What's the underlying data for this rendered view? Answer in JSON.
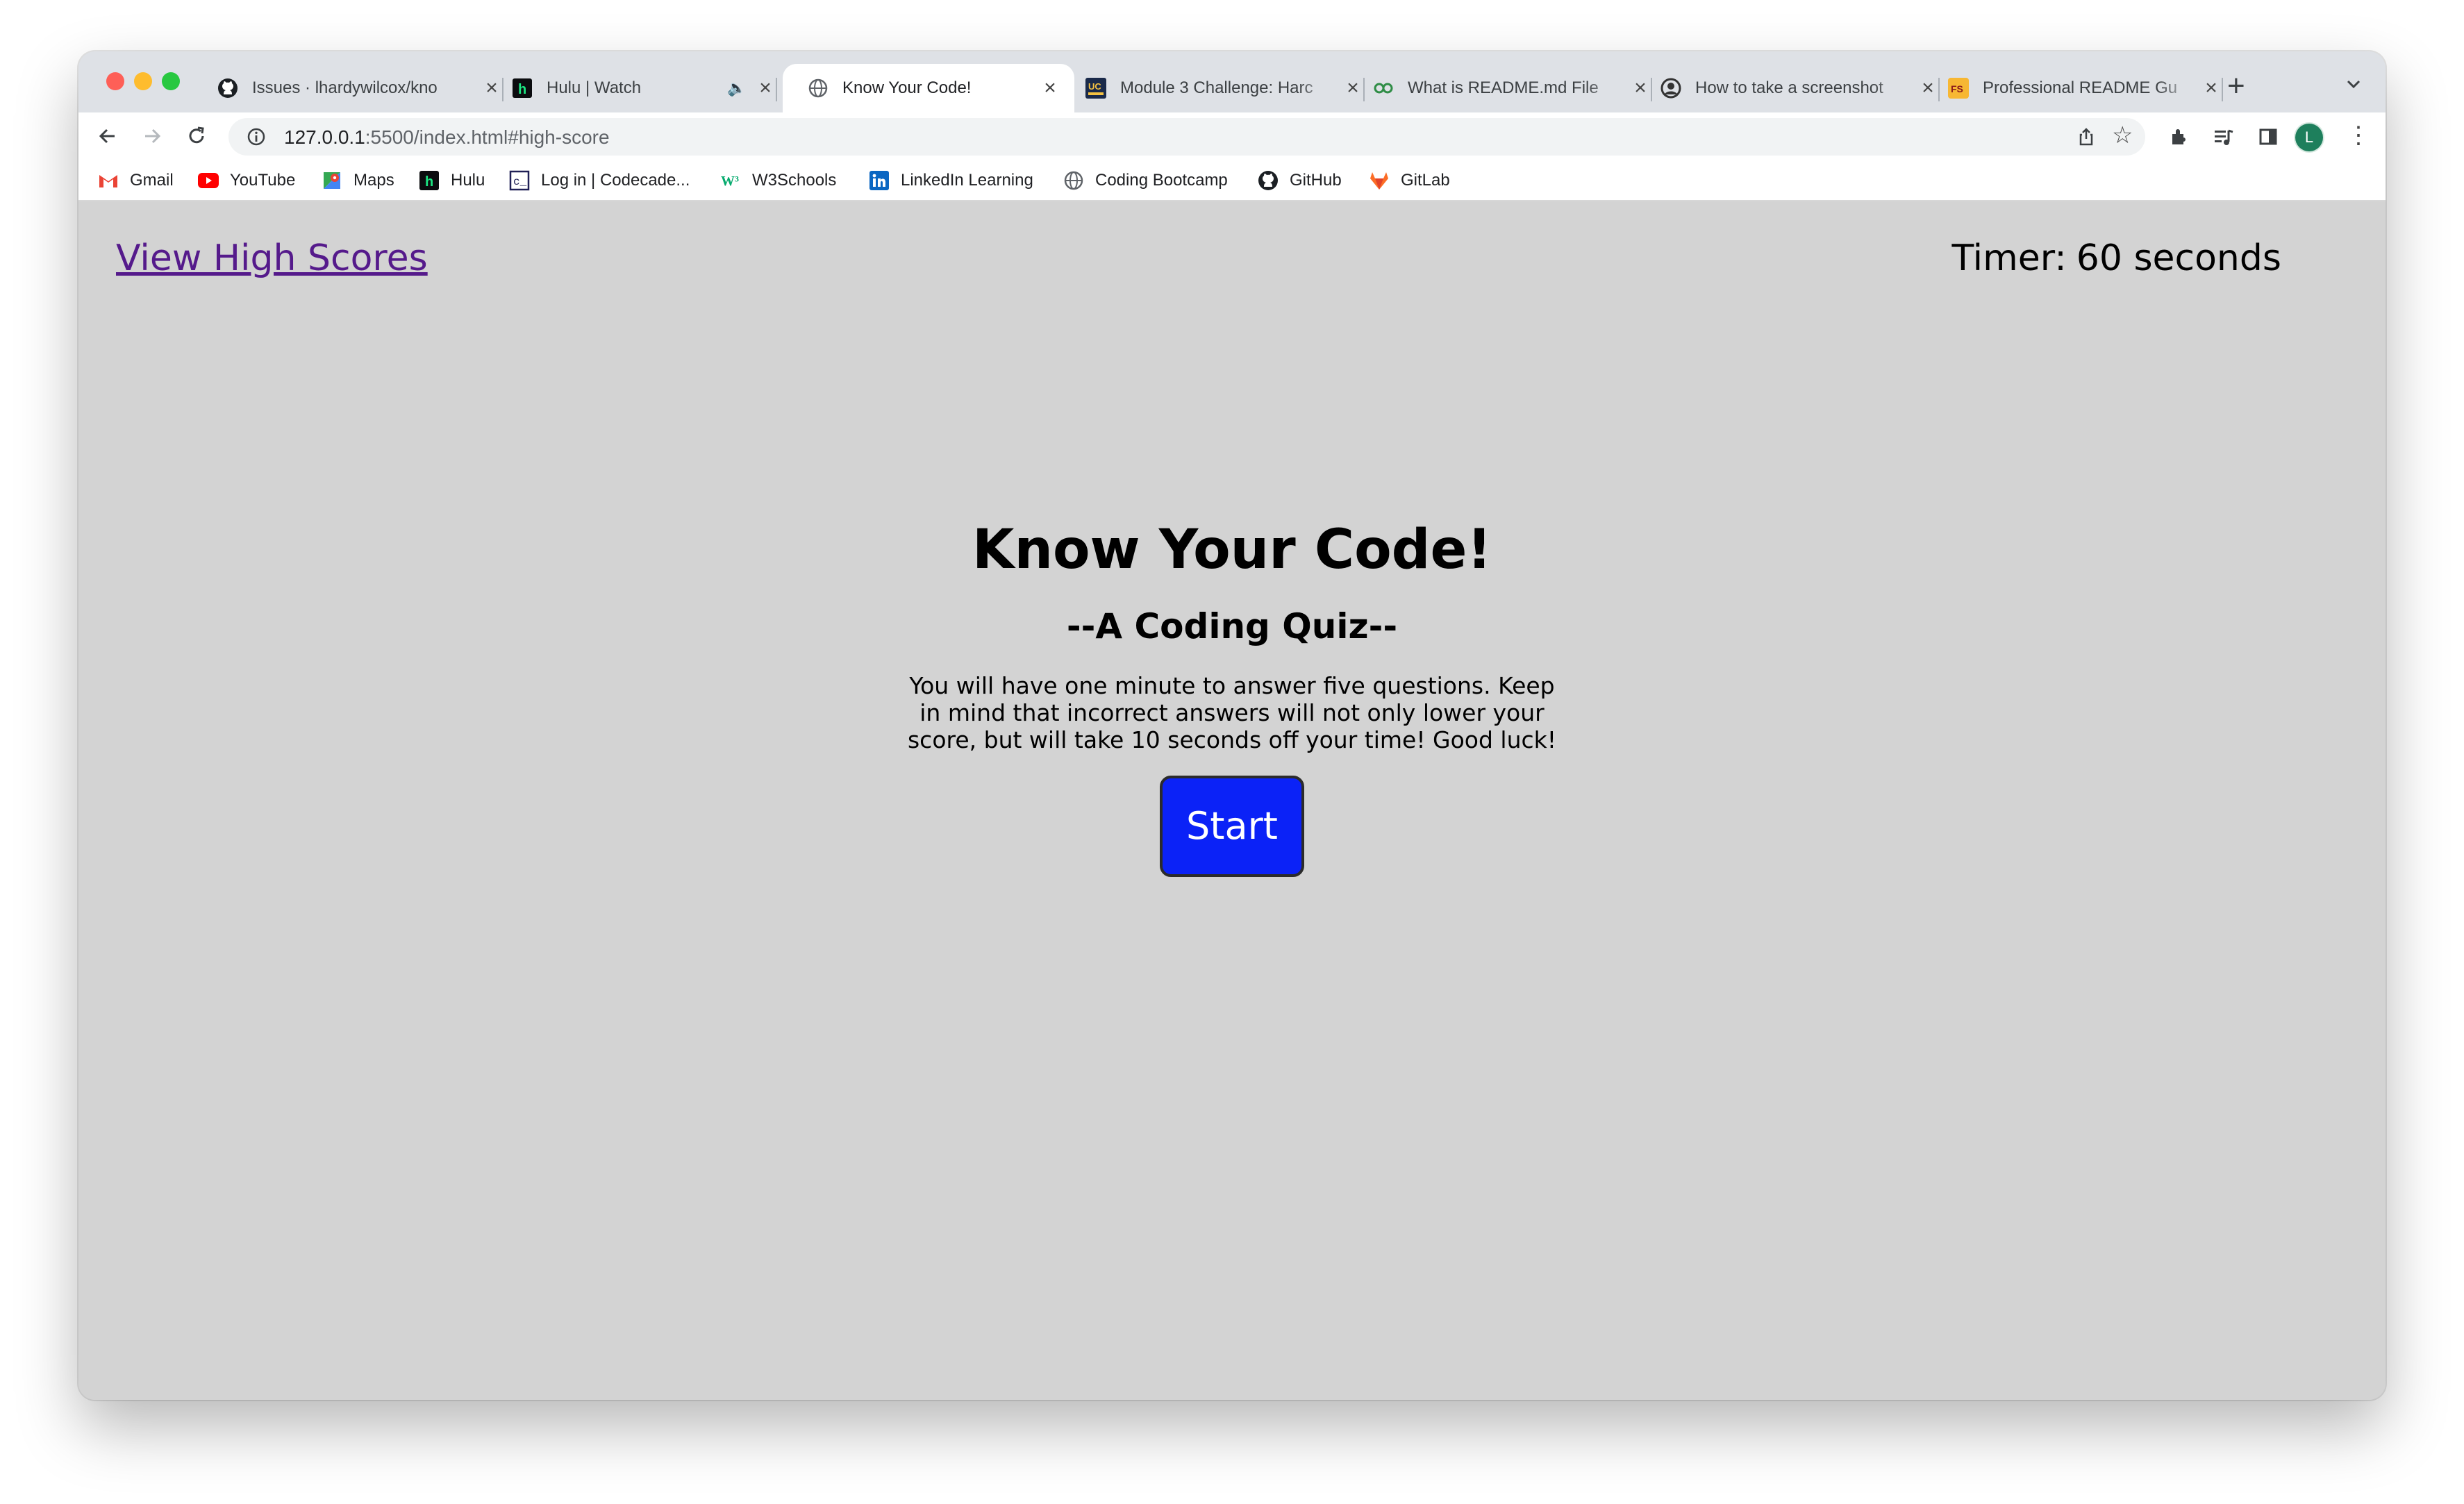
{
  "browser": {
    "tabs": [
      {
        "title": "Issues · lhardywilcox/kno",
        "icon": "github-icon",
        "active": false
      },
      {
        "title": "Hulu | Watch",
        "icon": "hulu-icon",
        "active": false,
        "audio": true
      },
      {
        "title": "Know Your Code!",
        "icon": "globe-icon",
        "active": true
      },
      {
        "title": "Module 3 Challenge: Harc",
        "icon": "ucb-icon",
        "active": false
      },
      {
        "title": "What is README.md File",
        "icon": "geeks-icon",
        "active": false
      },
      {
        "title": "How to take a screenshot",
        "icon": "avatar-icon",
        "active": false
      },
      {
        "title": "Professional README Gu",
        "icon": "fs-icon",
        "active": false
      }
    ],
    "url_host": "127.0.0.1",
    "url_path": ":5500/index.html#high-score",
    "avatar_letter": "L",
    "bookmarks": [
      {
        "label": "Gmail",
        "icon": "gmail-icon"
      },
      {
        "label": "YouTube",
        "icon": "youtube-icon"
      },
      {
        "label": "Maps",
        "icon": "maps-icon"
      },
      {
        "label": "Hulu",
        "icon": "hulu-icon"
      },
      {
        "label": "Log in | Codecade...",
        "icon": "codecademy-icon"
      },
      {
        "label": "W3Schools",
        "icon": "w3schools-icon"
      },
      {
        "label": "LinkedIn Learning",
        "icon": "linkedin-icon"
      },
      {
        "label": "Coding Bootcamp",
        "icon": "globe-icon"
      },
      {
        "label": "GitHub",
        "icon": "github-icon"
      },
      {
        "label": "GitLab",
        "icon": "gitlab-icon"
      }
    ]
  },
  "page": {
    "high_scores_link": "View High Scores",
    "timer_label": "Timer:",
    "timer_value": "60 seconds",
    "title": "Know Your Code!",
    "subtitle": "--A Coding Quiz--",
    "instructions": "You will have one minute to answer five questions. Keep in mind that incorrect answers will not only lower your score, but will take 10 seconds off your time! Good luck!",
    "start_button": "Start"
  },
  "colors": {
    "page_background": "#d3d3d3",
    "start_button": "#0b22f7",
    "link": "#551a8b"
  }
}
